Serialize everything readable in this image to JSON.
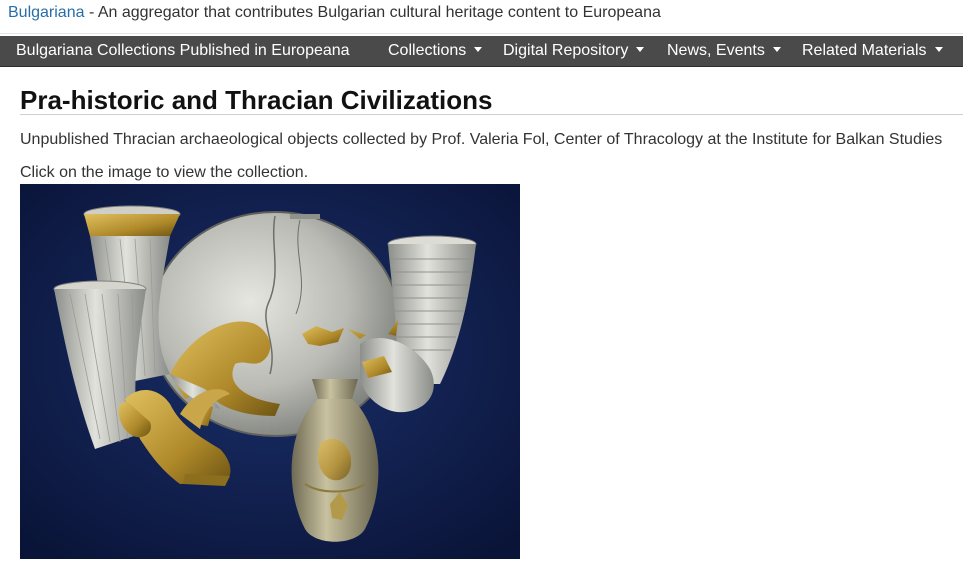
{
  "header": {
    "site_link": "Bulgariana",
    "tagline": " - An aggregator that contributes Bulgarian cultural heritage content to Europeana"
  },
  "nav": {
    "items": [
      {
        "label": "Bulgariana Collections Published in Europeana",
        "dropdown": false
      },
      {
        "label": "Collections",
        "dropdown": true
      },
      {
        "label": "Digital Repository",
        "dropdown": true
      },
      {
        "label": "News, Events",
        "dropdown": true
      },
      {
        "label": "Related Materials",
        "dropdown": true
      }
    ]
  },
  "main": {
    "title": "Pra-historic and Thracian Civilizations",
    "description": "Unpublished Thracian archaeological objects collected by Prof. Valeria Fol, Center of Thracology at the Institute for Balkan Studies",
    "hint": "Click on the image to view the collection."
  },
  "colors": {
    "link": "#2a6ea6",
    "nav_background": "#4a4a4a",
    "image_background": "#0f1e4a",
    "silver": "#c8c8c4",
    "gold": "#b8952e"
  }
}
